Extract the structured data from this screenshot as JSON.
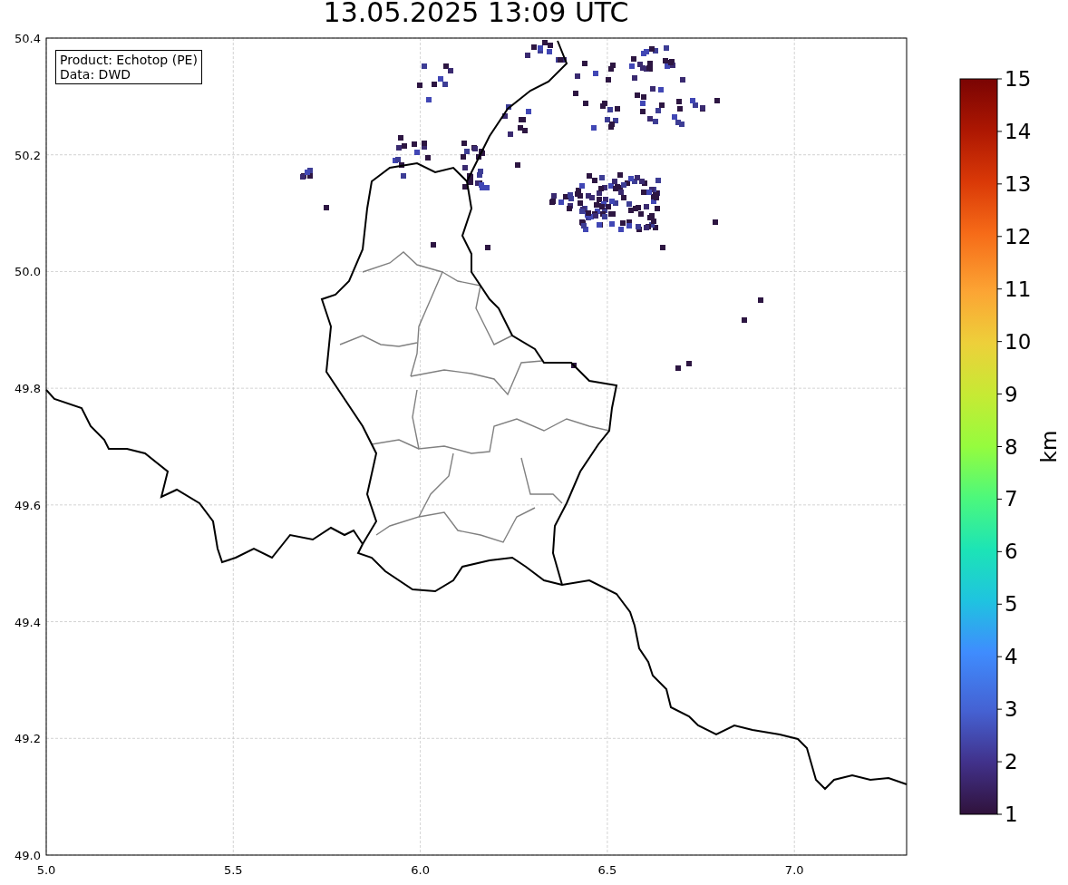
{
  "title": "13.05.2025 13:09 UTC",
  "info_box": {
    "lines": [
      "Product: Echotop (PE)",
      "Data: DWD"
    ]
  },
  "map": {
    "x_ticks": [
      "5.0",
      "5.5",
      "6.0",
      "6.5",
      "7.0"
    ],
    "y_ticks": [
      "50.4",
      "50.2",
      "50.0",
      "49.8",
      "49.6",
      "49.4",
      "49.2",
      "49.0"
    ]
  },
  "colorbar": {
    "label": "km",
    "ticks": [
      "15",
      "14",
      "13",
      "12",
      "11",
      "10",
      "9",
      "8",
      "7",
      "6",
      "5",
      "4",
      "3",
      "2",
      "1"
    ]
  }
}
